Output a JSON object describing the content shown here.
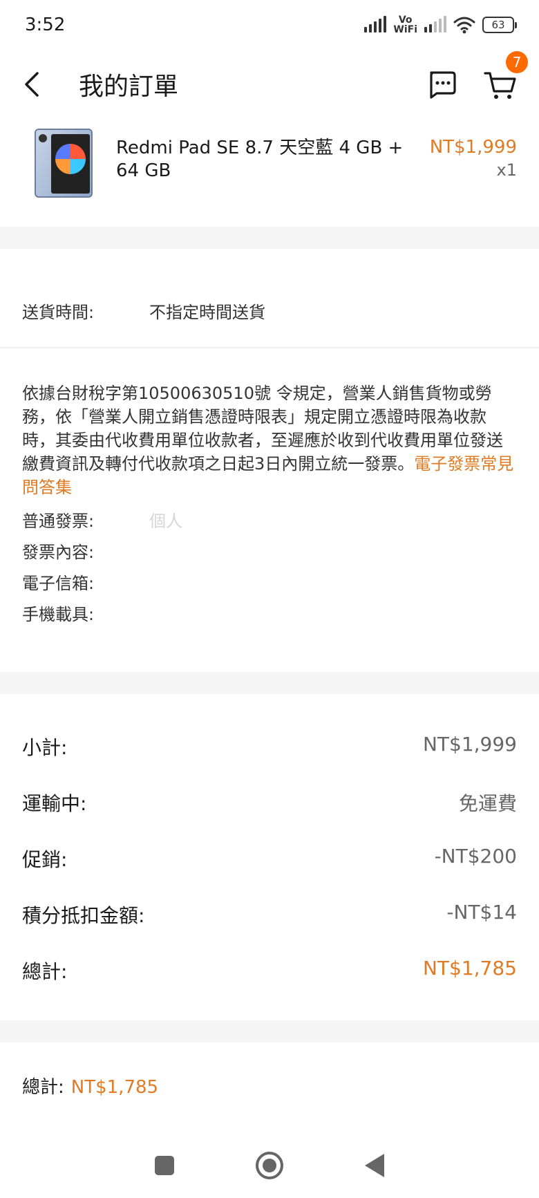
{
  "status_bar": {
    "time": "3:52",
    "vowifi_top": "Vo",
    "vowifi_bottom": "WiFi",
    "battery": "63"
  },
  "header": {
    "title": "我的訂單",
    "cart_badge": "7"
  },
  "product": {
    "name": "Redmi Pad SE 8.7 天空藍 4 GB + 64 GB",
    "price": "NT$1,999",
    "quantity": "x1"
  },
  "delivery": {
    "label": "送貨時間:",
    "value": "不指定時間送貨"
  },
  "invoice": {
    "notice": "依據台財稅字第10500630510號 令規定，營業人銷售貨物或勞務，依「營業人開立銷售憑證時限表」規定開立憑證時限為收款時，其委由代收費用單位收款者，至遲應於收到代收費用單位發送繳費資訊及轉付代收款項之日起3日內開立統一發票。",
    "faq_link": "電子發票常見問答集",
    "fields": [
      {
        "label": "普通發票:",
        "value": "個人"
      },
      {
        "label": "發票內容:",
        "value": ""
      },
      {
        "label": "電子信箱:",
        "value": ""
      },
      {
        "label": "手機載具:",
        "value": ""
      }
    ]
  },
  "summary": {
    "rows": [
      {
        "label": "小計:",
        "value": "NT$1,999"
      },
      {
        "label": "運輸中:",
        "value": "免運費"
      },
      {
        "label": "促銷:",
        "value": "-NT$200"
      },
      {
        "label": "積分抵扣金額:",
        "value": "-NT$14"
      },
      {
        "label": "總計:",
        "value": "NT$1,785"
      }
    ]
  },
  "footer": {
    "total_label": "總計:",
    "total_value": "NT$1,785"
  },
  "colors": {
    "accent": "#e07b24",
    "badge": "#ff6a00",
    "band": "#f5f5f5"
  }
}
